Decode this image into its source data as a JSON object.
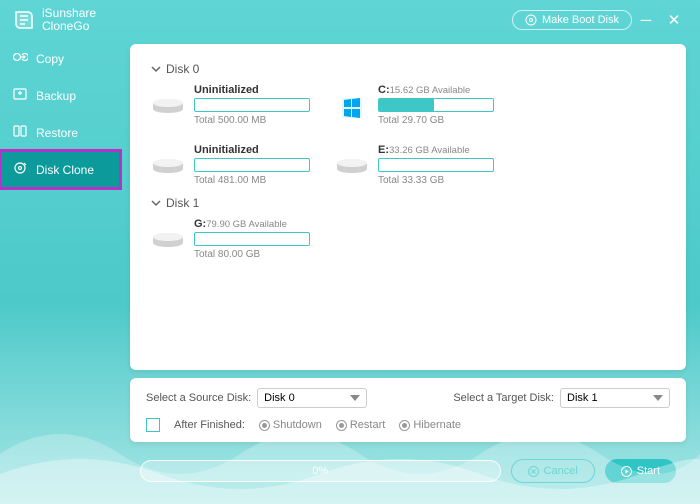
{
  "app": {
    "name1": "iSunshare",
    "name2": "CloneGo"
  },
  "header": {
    "makeBoot": "Make Boot Disk"
  },
  "sidebar": {
    "items": [
      {
        "icon": "copy",
        "label": "Copy"
      },
      {
        "icon": "backup",
        "label": "Backup"
      },
      {
        "icon": "restore",
        "label": "Restore"
      },
      {
        "icon": "clone",
        "label": "Disk Clone",
        "active": true
      }
    ]
  },
  "disks": [
    {
      "name": "Disk 0",
      "parts": [
        {
          "label": "Uninitialized",
          "sub": "",
          "fillPct": 0,
          "total": "Total 500.00 MB",
          "icon": "hdd"
        },
        {
          "label": "C:",
          "sub": "15.62 GB Available",
          "fillPct": 48,
          "total": "Total 29.70 GB",
          "icon": "win"
        },
        {
          "label": "Uninitialized",
          "sub": "",
          "fillPct": 0,
          "total": "Total 481.00 MB",
          "icon": "hdd"
        },
        {
          "label": "E:",
          "sub": "33.26 GB Available",
          "fillPct": 0,
          "total": "Total 33.33 GB",
          "icon": "hdd"
        }
      ]
    },
    {
      "name": "Disk 1",
      "parts": [
        {
          "label": "G:",
          "sub": "79.90 GB Available",
          "fillPct": 0,
          "total": "Total 80.00 GB",
          "icon": "hdd"
        }
      ]
    }
  ],
  "selectors": {
    "sourceLabel": "Select a Source Disk:",
    "sourceValue": "Disk 0",
    "targetLabel": "Select a Target Disk:",
    "targetValue": "Disk 1",
    "afterLabel": "After Finished:",
    "radios": [
      "Shutdown",
      "Restart",
      "Hibernate"
    ]
  },
  "footer": {
    "progress": "0%",
    "cancel": "Cancel",
    "start": "Start"
  }
}
